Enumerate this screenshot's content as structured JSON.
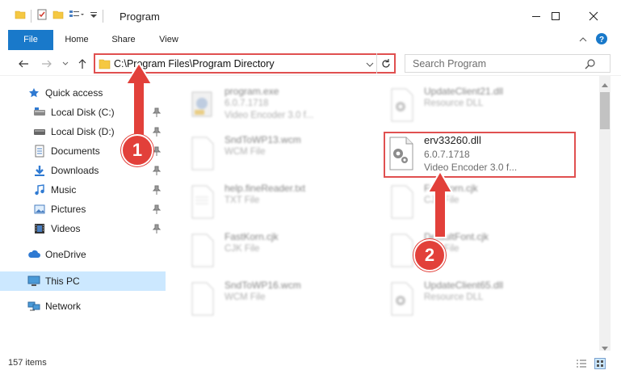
{
  "window": {
    "title": "Program",
    "accent": "#1979ca",
    "annotation_color": "#e2403a"
  },
  "ribbon": {
    "tabs": [
      "File",
      "Home",
      "Share",
      "View"
    ]
  },
  "address": {
    "path": "C:\\Program Files\\Program Directory",
    "search_placeholder": "Search Program"
  },
  "nav": {
    "quick_access": "Quick access",
    "items": [
      {
        "label": "Local Disk (C:)",
        "icon": "drive-icon"
      },
      {
        "label": "Local Disk (D:)",
        "icon": "drive-icon"
      },
      {
        "label": "Documents",
        "icon": "documents-icon"
      },
      {
        "label": "Downloads",
        "icon": "downloads-icon"
      },
      {
        "label": "Music",
        "icon": "music-icon"
      },
      {
        "label": "Pictures",
        "icon": "pictures-icon"
      },
      {
        "label": "Videos",
        "icon": "videos-icon"
      }
    ],
    "onedrive": "OneDrive",
    "this_pc": "This PC",
    "network": "Network"
  },
  "files": [
    {
      "name": "program.exe",
      "line2": "6.0.7.1718",
      "line3": "Video Encoder 3.0 f...",
      "type": "exe"
    },
    {
      "name": "UpdateClient21.dll",
      "line2": "Resource DLL",
      "line3": "",
      "type": "dll"
    },
    {
      "name": "SndToWP13.wcm",
      "line2": "WCM File",
      "line3": "",
      "type": "doc"
    },
    {
      "name": "erv33260.dll",
      "line2": "6.0.7.1718",
      "line3": "Video Encoder 3.0 f...",
      "type": "dll"
    },
    {
      "name": "help.fineReader.txt",
      "line2": "TXT File",
      "line3": "",
      "type": "txt"
    },
    {
      "name": "FastKorn.cjk",
      "line2": "CJK File",
      "line3": "",
      "type": "doc"
    },
    {
      "name": "FastKorn.cjk",
      "line2": "CJK File",
      "line3": "",
      "type": "doc"
    },
    {
      "name": "DefaultFont.cjk",
      "line2": "CJK File",
      "line3": "",
      "type": "doc"
    },
    {
      "name": "SndToWP16.wcm",
      "line2": "WCM File",
      "line3": "",
      "type": "doc"
    },
    {
      "name": "UpdateClient65.dll",
      "line2": "Resource DLL",
      "line3": "",
      "type": "dll"
    }
  ],
  "status": {
    "item_count": "157 items"
  },
  "markers": [
    "1",
    "2"
  ]
}
